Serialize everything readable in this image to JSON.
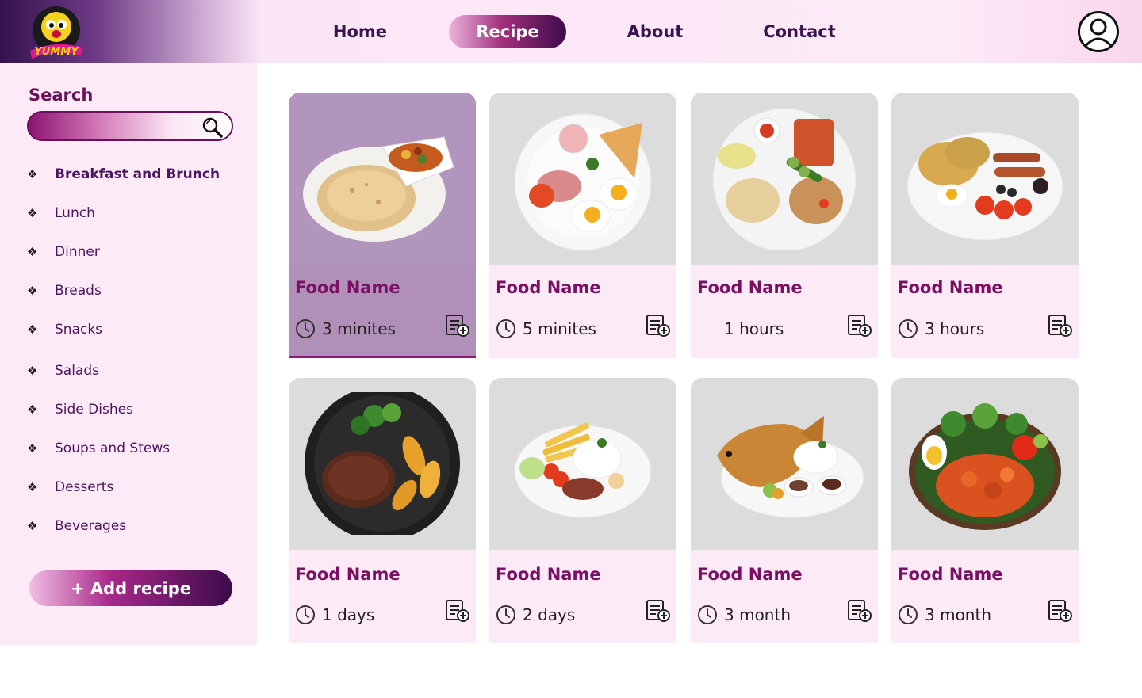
{
  "header": {
    "logo_text": "YUMMY",
    "nav": [
      {
        "label": "Home",
        "active": false
      },
      {
        "label": "Recipe",
        "active": true
      },
      {
        "label": "About",
        "active": false
      },
      {
        "label": "Contact",
        "active": false
      }
    ],
    "user_icon": "user-avatar-icon"
  },
  "sidebar": {
    "search_label": "Search",
    "search_placeholder": "",
    "search_icon": "magnifier-icon",
    "categories": [
      {
        "label": "Breakfast and Brunch",
        "active": true
      },
      {
        "label": "Lunch",
        "active": false
      },
      {
        "label": "Dinner",
        "active": false
      },
      {
        "label": "Breads",
        "active": false
      },
      {
        "label": "Snacks",
        "active": false
      },
      {
        "label": "Salads",
        "active": false
      },
      {
        "label": "Side Dishes",
        "active": false
      },
      {
        "label": "Soups and Stews",
        "active": false
      },
      {
        "label": "Desserts",
        "active": false
      },
      {
        "label": "Beverages",
        "active": false
      }
    ],
    "category_bullet": "❖",
    "add_recipe_label": "+ Add recipe"
  },
  "recipes": [
    {
      "name": "Food Name",
      "time": "3 minites",
      "show_clock": true,
      "active": true,
      "image": "paratha-with-curry"
    },
    {
      "name": "Food Name",
      "time": "5 minites",
      "show_clock": true,
      "active": false,
      "image": "eggs-ham-toast"
    },
    {
      "name": "Food Name",
      "time": "1 hours",
      "show_clock": false,
      "active": false,
      "image": "mixed-platter"
    },
    {
      "name": "Food Name",
      "time": "3 hours",
      "show_clock": true,
      "active": false,
      "image": "english-breakfast"
    },
    {
      "name": "Food Name",
      "time": "1 days",
      "show_clock": true,
      "active": false,
      "image": "steak-with-potatoes"
    },
    {
      "name": "Food Name",
      "time": "2 days",
      "show_clock": true,
      "active": false,
      "image": "rice-fries-steak"
    },
    {
      "name": "Food Name",
      "time": "3 month",
      "show_clock": true,
      "active": false,
      "image": "fried-fish-rice"
    },
    {
      "name": "Food Name",
      "time": "3 month",
      "show_clock": true,
      "active": false,
      "image": "fried-chicken-salad"
    }
  ],
  "colors": {
    "accent": "#7a0f64",
    "nav_text": "#3b1350",
    "sidebar_bg": "#fdeaf7",
    "card_photo_bg": "#dcdcdc",
    "active_card_bg": "#b090b8"
  }
}
